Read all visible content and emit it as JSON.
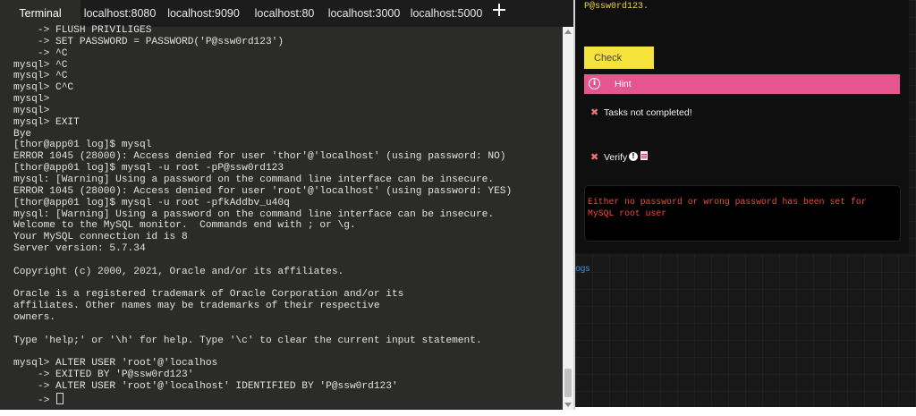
{
  "tabs": [
    {
      "label": "Terminal",
      "active": true
    },
    {
      "label": "localhost:8080",
      "active": false
    },
    {
      "label": "localhost:9090",
      "active": false
    },
    {
      "label": "localhost:80",
      "active": false
    },
    {
      "label": "localhost:3000",
      "active": false
    },
    {
      "label": "localhost:5000",
      "active": false
    }
  ],
  "add_tab_icon": "plus-icon",
  "terminal": {
    "lines": [
      "    -> FLUSH PRIVILIGES",
      "    -> SET PASSWORD = PASSWORD('P@ssw0rd123')",
      "    -> ^C",
      "mysql> ^C",
      "mysql> ^C",
      "mysql> C^C",
      "mysql>",
      "mysql>",
      "mysql> EXIT",
      "Bye",
      "[thor@app01 log]$ mysql",
      "ERROR 1045 (28000): Access denied for user 'thor'@'localhost' (using password: NO)",
      "[thor@app01 log]$ mysql -u root -pP@ssw0rd123",
      "mysql: [Warning] Using a password on the command line interface can be insecure.",
      "ERROR 1045 (28000): Access denied for user 'root'@'localhost' (using password: YES)",
      "[thor@app01 log]$ mysql -u root -pfkAddbv_u40q",
      "mysql: [Warning] Using a password on the command line interface can be insecure.",
      "Welcome to the MySQL monitor.  Commands end with ; or \\g.",
      "Your MySQL connection id is 8",
      "Server version: 5.7.34",
      "",
      "Copyright (c) 2000, 2021, Oracle and/or its affiliates.",
      "",
      "Oracle is a registered trademark of Oracle Corporation and/or its",
      "affiliates. Other names may be trademarks of their respective",
      "owners.",
      "",
      "Type 'help;' or '\\h' for help. Type '\\c' to clear the current input statement.",
      "",
      "mysql> ALTER USER 'root'@'localhos",
      "    -> EXITED BY 'P@ssw0rd123'",
      "    -> ALTER USER 'root'@'localhost' IDENTIFIED BY 'P@ssw0rd123'"
    ],
    "prompt": "    -> "
  },
  "panel": {
    "top_command_fragment": "P@ssw0rd123.",
    "check_label": "Check",
    "hint_label": "Hint",
    "hint_icon": "info-circle-icon",
    "tasks_status": "Tasks not completed!",
    "verify_label": "Verify",
    "verify_icons": [
      "warning-circle-icon",
      "document-icon"
    ],
    "error_message": "Either no password or wrong password has been set for MySQL root user",
    "logs_link": "logs"
  },
  "colors": {
    "terminal_bg": "#2b2b29",
    "check_button": "#f5e23a",
    "hint_bar": "#e5558e",
    "error_text": "#f04a3c",
    "link": "#3f8fe0"
  }
}
